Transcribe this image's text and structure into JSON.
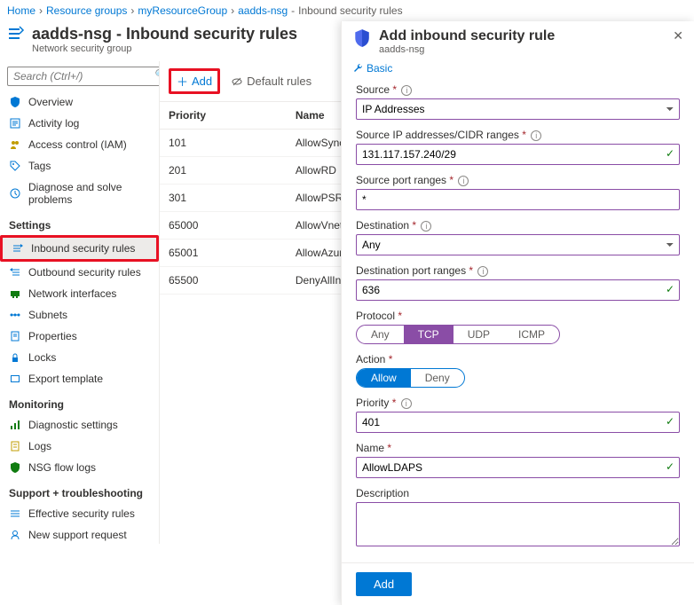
{
  "breadcrumb": {
    "home": "Home",
    "rg": "Resource groups",
    "group": "myResourceGroup",
    "nsg": "aadds-nsg",
    "page": "Inbound security rules"
  },
  "header": {
    "title": "aadds-nsg - Inbound security rules",
    "subtitle": "Network security group"
  },
  "search": {
    "placeholder": "Search (Ctrl+/)"
  },
  "nav": {
    "overview": "Overview",
    "activity": "Activity log",
    "iam": "Access control (IAM)",
    "tags": "Tags",
    "diagnose": "Diagnose and solve problems",
    "section_settings": "Settings",
    "inbound": "Inbound security rules",
    "outbound": "Outbound security rules",
    "nics": "Network interfaces",
    "subnets": "Subnets",
    "properties": "Properties",
    "locks": "Locks",
    "export": "Export template",
    "section_monitoring": "Monitoring",
    "diag": "Diagnostic settings",
    "logs": "Logs",
    "flow": "NSG flow logs",
    "section_support": "Support + troubleshooting",
    "effective": "Effective security rules",
    "newreq": "New support request"
  },
  "toolbar": {
    "add": "Add",
    "default_rules": "Default rules"
  },
  "table": {
    "headers": {
      "priority": "Priority",
      "name": "Name"
    },
    "rows": [
      {
        "priority": "101",
        "name": "AllowSyncWithAzureAD"
      },
      {
        "priority": "201",
        "name": "AllowRD"
      },
      {
        "priority": "301",
        "name": "AllowPSRemoting"
      },
      {
        "priority": "65000",
        "name": "AllowVnetInBound"
      },
      {
        "priority": "65001",
        "name": "AllowAzureLoadBalancerInBound"
      },
      {
        "priority": "65500",
        "name": "DenyAllInBound"
      }
    ]
  },
  "panel": {
    "title": "Add inbound security rule",
    "subtitle": "aadds-nsg",
    "basic_tab": "Basic",
    "labels": {
      "source": "Source",
      "source_ip": "Source IP addresses/CIDR ranges",
      "source_port": "Source port ranges",
      "destination": "Destination",
      "dest_port": "Destination port ranges",
      "protocol": "Protocol",
      "action": "Action",
      "priority": "Priority",
      "name": "Name",
      "description": "Description"
    },
    "values": {
      "source": "IP Addresses",
      "source_ip": "131.117.157.240/29",
      "source_port": "*",
      "destination": "Any",
      "dest_port": "636",
      "priority": "401",
      "name": "AllowLDAPS",
      "description": ""
    },
    "protocol_opts": {
      "any": "Any",
      "tcp": "TCP",
      "udp": "UDP",
      "icmp": "ICMP"
    },
    "action_opts": {
      "allow": "Allow",
      "deny": "Deny"
    },
    "submit": "Add"
  }
}
